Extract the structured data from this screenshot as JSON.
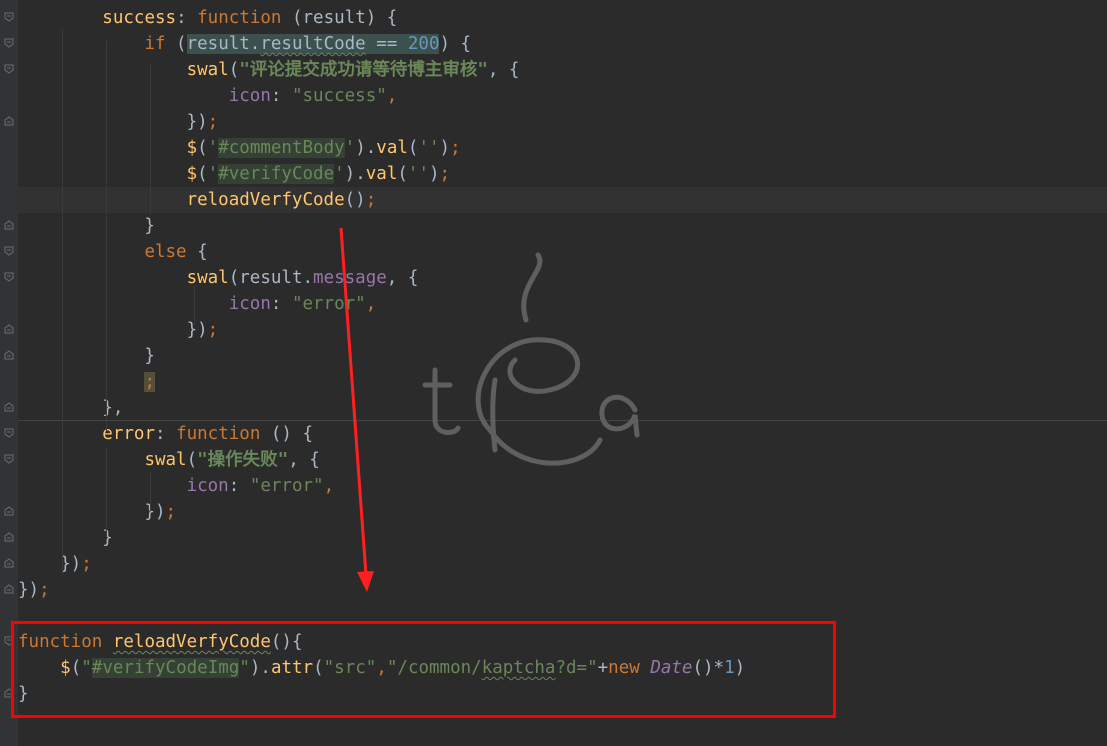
{
  "editor": {
    "lines": [
      {
        "parts": [
          {
            "t": "        "
          },
          {
            "t": "success",
            "c": "fn"
          },
          {
            "t": ": "
          },
          {
            "t": "function",
            "c": "kw"
          },
          {
            "t": " (result) {"
          }
        ]
      },
      {
        "parts": [
          {
            "t": "            "
          },
          {
            "t": "if",
            "c": "kw"
          },
          {
            "t": " ("
          },
          {
            "t": "result.",
            "c": "hl"
          },
          {
            "t": "resultCode",
            "c": "hlwav"
          },
          {
            "t": " == ",
            "c": "hl"
          },
          {
            "t": "200",
            "c": "numhl"
          },
          {
            "t": ") {"
          }
        ]
      },
      {
        "parts": [
          {
            "t": "                "
          },
          {
            "t": "swal",
            "c": "fn"
          },
          {
            "t": "("
          },
          {
            "t": "\"评论提交成功请等待博主审核\"",
            "c": "strb"
          },
          {
            "t": ", {"
          }
        ]
      },
      {
        "parts": [
          {
            "t": "                    "
          },
          {
            "t": "icon",
            "c": "purple"
          },
          {
            "t": ": "
          },
          {
            "t": "\"success\"",
            "c": "str"
          },
          {
            "t": ",",
            "c": "kw"
          }
        ]
      },
      {
        "parts": [
          {
            "t": "                "
          },
          {
            "t": "})"
          },
          {
            "t": ";",
            "c": "kw"
          }
        ]
      },
      {
        "parts": [
          {
            "t": "                "
          },
          {
            "t": "$",
            "c": "fn"
          },
          {
            "t": "("
          },
          {
            "t": "'",
            "c": "str"
          },
          {
            "t": "#commentBody",
            "c": "strhl"
          },
          {
            "t": "'",
            "c": "str"
          },
          {
            "t": ")."
          },
          {
            "t": "val",
            "c": "fn"
          },
          {
            "t": "("
          },
          {
            "t": "''",
            "c": "str"
          },
          {
            "t": ")"
          },
          {
            "t": ";",
            "c": "kw"
          }
        ]
      },
      {
        "parts": [
          {
            "t": "                "
          },
          {
            "t": "$",
            "c": "fn"
          },
          {
            "t": "("
          },
          {
            "t": "'",
            "c": "str"
          },
          {
            "t": "#verifyCode",
            "c": "strhl"
          },
          {
            "t": "'",
            "c": "str"
          },
          {
            "t": ")."
          },
          {
            "t": "val",
            "c": "fn"
          },
          {
            "t": "("
          },
          {
            "t": "''",
            "c": "str"
          },
          {
            "t": ")"
          },
          {
            "t": ";",
            "c": "kw"
          }
        ]
      },
      {
        "parts": [
          {
            "t": "                "
          },
          {
            "t": "reloadVerfyCode",
            "c": "fn"
          },
          {
            "t": "()"
          },
          {
            "t": ";",
            "c": "kw"
          }
        ]
      },
      {
        "parts": [
          {
            "t": "            }"
          }
        ]
      },
      {
        "parts": [
          {
            "t": "            "
          },
          {
            "t": "else",
            "c": "kw"
          },
          {
            "t": " {"
          }
        ]
      },
      {
        "parts": [
          {
            "t": "                "
          },
          {
            "t": "swal",
            "c": "fn"
          },
          {
            "t": "(result."
          },
          {
            "t": "message",
            "c": "purple"
          },
          {
            "t": ", {"
          }
        ]
      },
      {
        "parts": [
          {
            "t": "                    "
          },
          {
            "t": "icon",
            "c": "purple"
          },
          {
            "t": ": "
          },
          {
            "t": "\"error\"",
            "c": "str"
          },
          {
            "t": ",",
            "c": "kw"
          }
        ]
      },
      {
        "parts": [
          {
            "t": "                "
          },
          {
            "t": "})"
          },
          {
            "t": ";",
            "c": "kw"
          }
        ]
      },
      {
        "parts": [
          {
            "t": "            }"
          }
        ]
      },
      {
        "parts": [
          {
            "t": "            "
          },
          {
            "t": ";",
            "c": "semi"
          }
        ]
      },
      {
        "parts": [
          {
            "t": "        },",
            "c": "plain"
          }
        ]
      },
      {
        "parts": [
          {
            "t": "        "
          },
          {
            "t": "error",
            "c": "fn"
          },
          {
            "t": ": "
          },
          {
            "t": "function",
            "c": "kw"
          },
          {
            "t": " () {"
          }
        ]
      },
      {
        "parts": [
          {
            "t": "            "
          },
          {
            "t": "swal",
            "c": "fn"
          },
          {
            "t": "("
          },
          {
            "t": "\"操作失败\"",
            "c": "strb"
          },
          {
            "t": ", {"
          }
        ]
      },
      {
        "parts": [
          {
            "t": "                "
          },
          {
            "t": "icon",
            "c": "purple"
          },
          {
            "t": ": "
          },
          {
            "t": "\"error\"",
            "c": "str"
          },
          {
            "t": ",",
            "c": "kw"
          }
        ]
      },
      {
        "parts": [
          {
            "t": "            "
          },
          {
            "t": "})"
          },
          {
            "t": ";",
            "c": "kw"
          }
        ]
      },
      {
        "parts": [
          {
            "t": "        }"
          }
        ]
      },
      {
        "parts": [
          {
            "t": "    })"
          },
          {
            "t": ";",
            "c": "kw"
          }
        ]
      },
      {
        "parts": [
          {
            "t": "})"
          },
          {
            "t": ";",
            "c": "kw"
          }
        ]
      },
      {
        "parts": [
          {
            "t": ""
          }
        ]
      },
      {
        "parts": [
          {
            "t": "function",
            "c": "kw"
          },
          {
            "t": " "
          },
          {
            "t": "reloadVerfyCode",
            "c": "fnwav"
          },
          {
            "t": "(){"
          }
        ]
      },
      {
        "parts": [
          {
            "t": "    "
          },
          {
            "t": "$",
            "c": "fn"
          },
          {
            "t": "("
          },
          {
            "t": "\"",
            "c": "str"
          },
          {
            "t": "#verifyCodeImg",
            "c": "strhl"
          },
          {
            "t": "\"",
            "c": "str"
          },
          {
            "t": ")."
          },
          {
            "t": "attr",
            "c": "fn"
          },
          {
            "t": "("
          },
          {
            "t": "\"src\"",
            "c": "str"
          },
          {
            "t": ",",
            "c": "kw"
          },
          {
            "t": "\"/common/",
            "c": "str"
          },
          {
            "t": "kaptcha",
            "c": "strwav"
          },
          {
            "t": "?d=\"",
            "c": "str"
          },
          {
            "t": "+"
          },
          {
            "t": "new",
            "c": "kw"
          },
          {
            "t": " "
          },
          {
            "t": "Date",
            "c": "italp"
          },
          {
            "t": "()*"
          },
          {
            "t": "1",
            "c": "num"
          },
          {
            "t": ")"
          }
        ]
      },
      {
        "parts": [
          {
            "t": "}"
          }
        ]
      }
    ]
  },
  "colors": {
    "background": "#2b2b2b",
    "keyword": "#cc7832",
    "function": "#ffc66d",
    "string": "#6a8759",
    "number": "#6897bb",
    "property": "#9876aa",
    "annotation_box": "#ff0000",
    "arrow": "#ff0000"
  },
  "icons": {
    "fold_markers": "fold-marker-icon",
    "watermark": "tea-logo-icon",
    "annotation_arrow": "red-arrow-icon"
  }
}
